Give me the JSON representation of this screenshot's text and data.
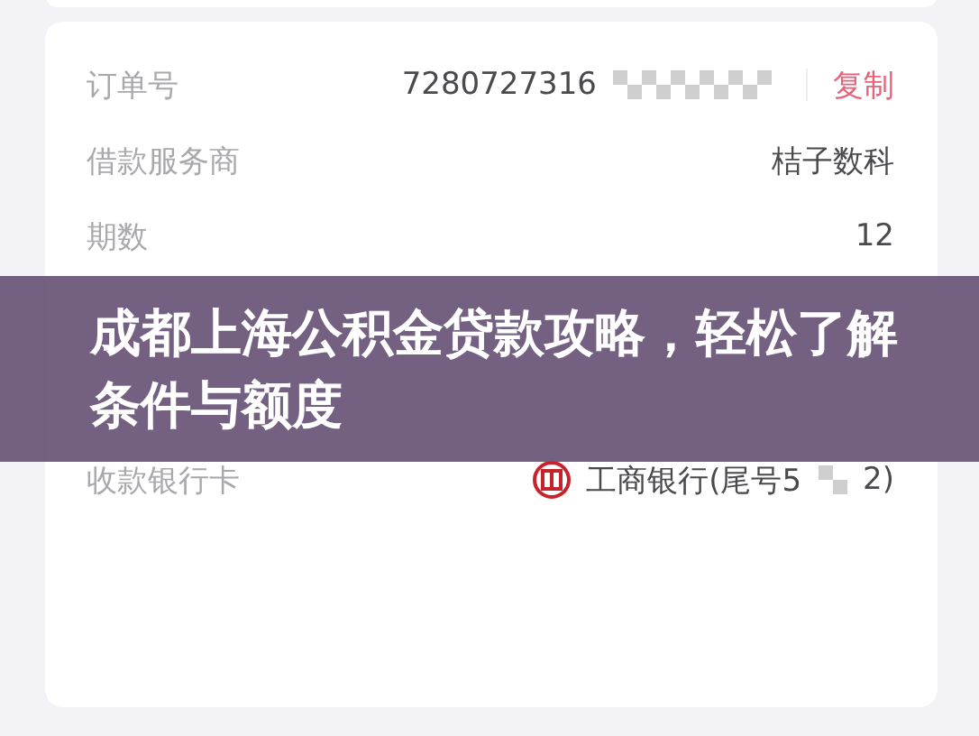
{
  "order_details": {
    "rows": [
      {
        "kind": "copy",
        "label": "订单号",
        "value": "7280727316",
        "action": "复制"
      },
      {
        "kind": "text",
        "label": "借款服务商",
        "value": "桔子数科"
      },
      {
        "kind": "text",
        "label": "期数",
        "value": "12"
      },
      {
        "kind": "hidden"
      },
      {
        "kind": "hidden"
      },
      {
        "kind": "bank",
        "label": "收款银行卡",
        "value": "工商银行(尾号5",
        "value_end": "2)"
      }
    ]
  },
  "banner": {
    "title": "成都上海公积金贷款攻略，轻松了解条件与额度"
  }
}
